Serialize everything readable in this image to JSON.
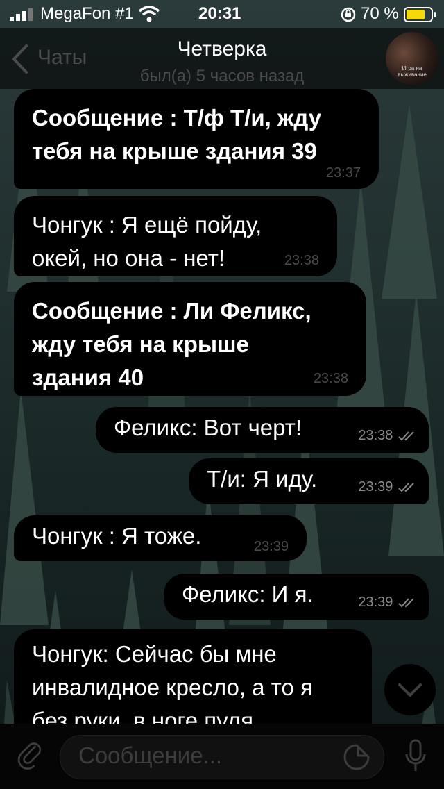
{
  "status_bar": {
    "carrier": "MegaFon #1",
    "time": "20:31",
    "battery_percent": "70 %"
  },
  "header": {
    "back_label": "Чаты",
    "title": "Четверка",
    "subtitle": "был(а) 5 часов назад",
    "avatar_caption": "Игра на выживание"
  },
  "messages": [
    {
      "text": "Сообщение : Т/ф Т/и, жду\nтебя на крыше здания 39",
      "time": "23:37",
      "direction": "incoming",
      "bold": true
    },
    {
      "text": "Чонгук : Я ещё пойду,\nокей, но она - нет!",
      "time": "23:38",
      "direction": "incoming",
      "bold": false
    },
    {
      "text": "Сообщение : Ли Феликс,\nжду тебя на крыше\nздания 40",
      "time": "23:38",
      "direction": "incoming",
      "bold": true
    },
    {
      "text": "Феликс: Вот черт!",
      "time": "23:38",
      "direction": "outgoing",
      "bold": false
    },
    {
      "text": "Т/и: Я иду.",
      "time": "23:39",
      "direction": "outgoing",
      "bold": false
    },
    {
      "text": "Чонгук : Я тоже.",
      "time": "23:39",
      "direction": "incoming",
      "bold": false
    },
    {
      "text": "Феликс: И я.",
      "time": "23:39",
      "direction": "outgoing",
      "bold": false
    },
    {
      "text": "Чонгук: Сейчас бы мне\nинвалидное кресло, а то я\nбез руки, в ноге пуля",
      "direction": "incoming",
      "bold": false
    }
  ],
  "input": {
    "placeholder": "Сообщение..."
  },
  "icons": {
    "back": "chevron-left-icon",
    "scroll_down": "chevron-down-icon",
    "attach": "paperclip-icon",
    "sticker": "sticker-icon",
    "mic": "microphone-icon"
  },
  "colors": {
    "bubble": "#000000",
    "secondary_text": "#4b4b4b",
    "wallpaper": "#1a2a2a"
  }
}
